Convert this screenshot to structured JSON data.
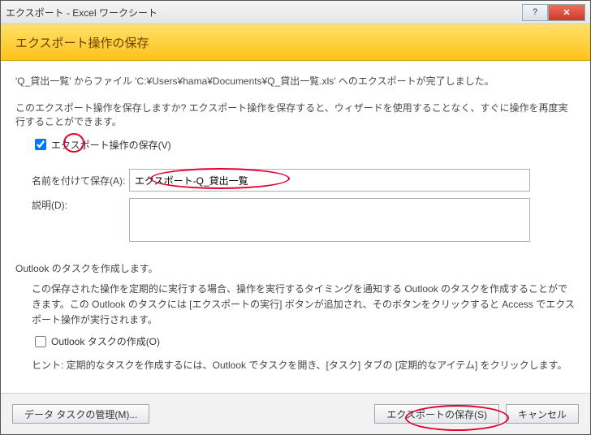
{
  "window": {
    "title": "エクスポート - Excel ワークシート"
  },
  "header": {
    "title": "エクスポート操作の保存"
  },
  "body": {
    "msg": "'Q_貸出一覧' からファイル 'C:¥Users¥hama¥Documents¥Q_貸出一覧.xls' へのエクスポートが完了しました。",
    "question": "このエクスポート操作を保存しますか? エクスポート操作を保存すると、ウィザードを使用することなく、すぐに操作を再度実行することができます。",
    "save_checkbox": "エクスポート操作の保存(V)",
    "name_label": "名前を付けて保存(A):",
    "name_value": "エクスポート-Q_貸出一覧",
    "desc_label": "説明(D):",
    "desc_value": "",
    "outlook_heading": "Outlook のタスクを作成します。",
    "outlook_note": "この保存された操作を定期的に実行する場合、操作を実行するタイミングを通知する Outlook のタスクを作成することができます。この Outlook のタスクには [エクスポートの実行] ボタンが追加され、そのボタンをクリックすると Access でエクスポート操作が実行されます。",
    "outlook_checkbox": "Outlook タスクの作成(O)",
    "hint": "ヒント: 定期的なタスクを作成するには、Outlook でタスクを開き、[タスク] タブの [定期的なアイテム] をクリックします。"
  },
  "footer": {
    "manage": "データ タスクの管理(M)...",
    "save": "エクスポートの保存(S)",
    "cancel": "キャンセル"
  }
}
